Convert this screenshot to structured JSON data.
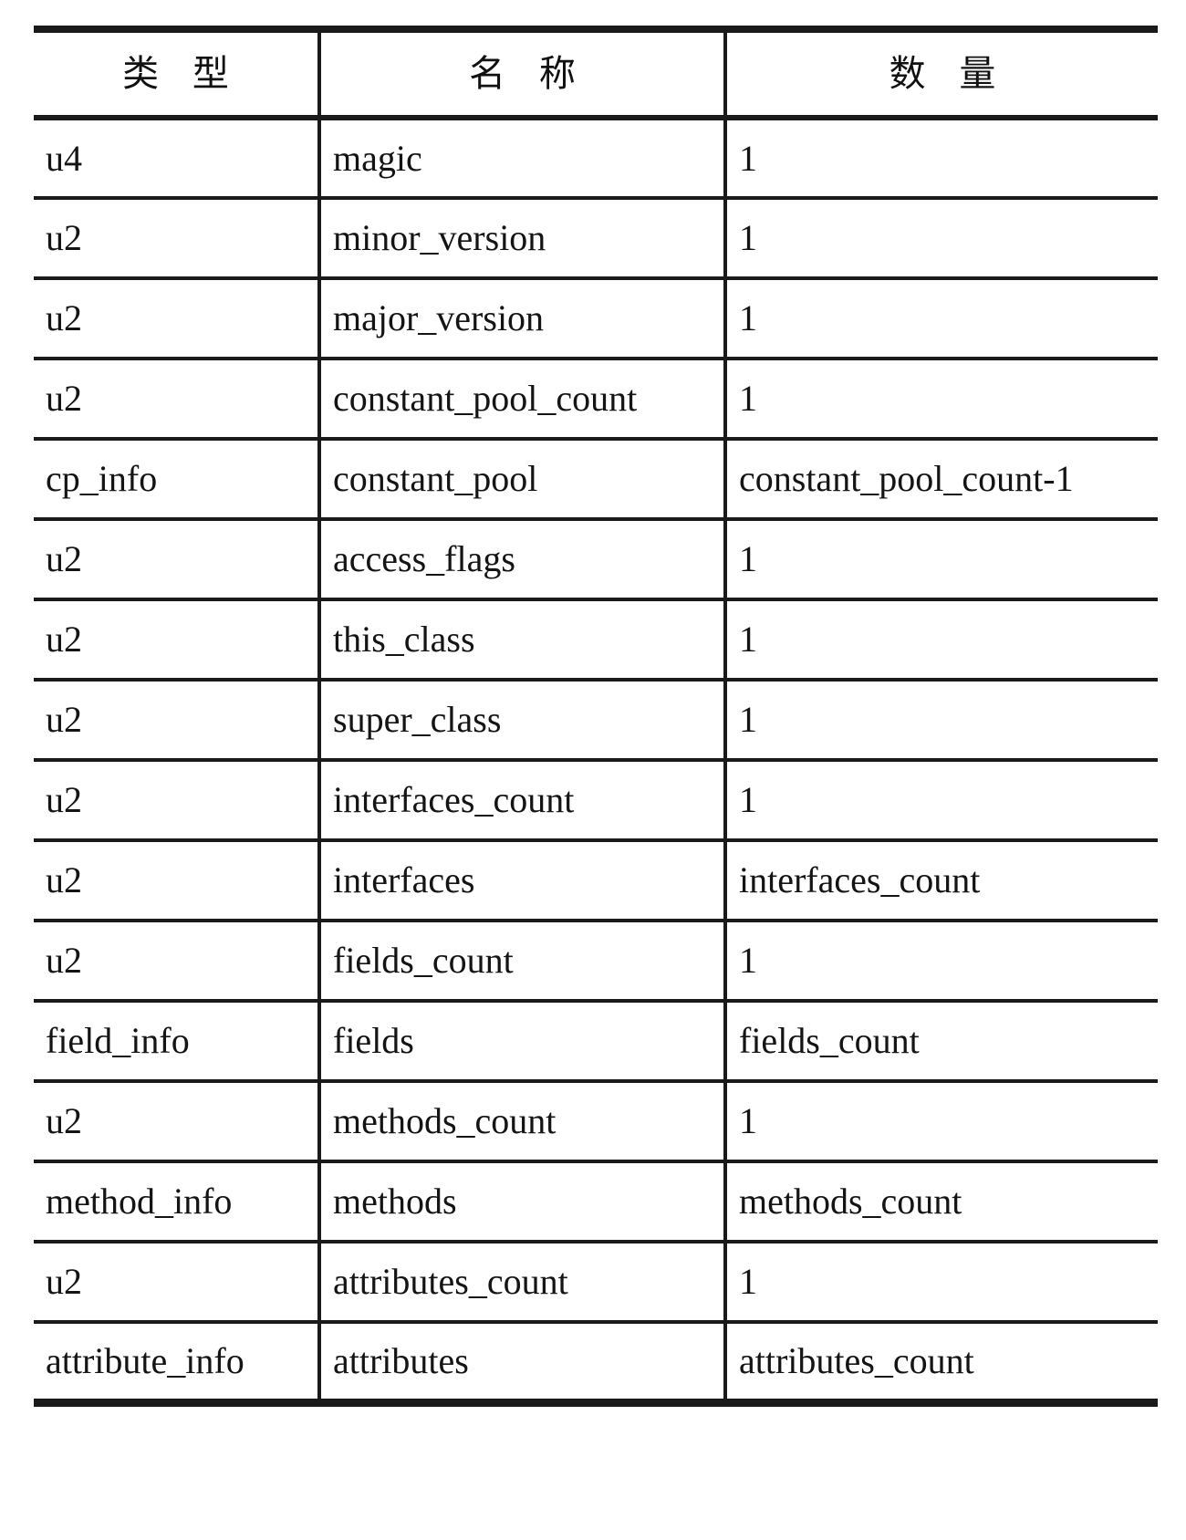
{
  "table": {
    "columns": [
      {
        "key": "type",
        "header": "类 型"
      },
      {
        "key": "name",
        "header": "名 称"
      },
      {
        "key": "quantity",
        "header": "数 量"
      }
    ],
    "rows": [
      {
        "type": "u4",
        "name": "magic",
        "quantity": "1"
      },
      {
        "type": "u2",
        "name": "minor_version",
        "quantity": "1"
      },
      {
        "type": "u2",
        "name": "major_version",
        "quantity": "1"
      },
      {
        "type": "u2",
        "name": "constant_pool_count",
        "quantity": "1"
      },
      {
        "type": "cp_info",
        "name": "constant_pool",
        "quantity": "constant_pool_count-1"
      },
      {
        "type": "u2",
        "name": "access_flags",
        "quantity": "1"
      },
      {
        "type": "u2",
        "name": "this_class",
        "quantity": "1"
      },
      {
        "type": "u2",
        "name": "super_class",
        "quantity": "1"
      },
      {
        "type": "u2",
        "name": "interfaces_count",
        "quantity": "1"
      },
      {
        "type": "u2",
        "name": "interfaces",
        "quantity": "interfaces_count"
      },
      {
        "type": "u2",
        "name": "fields_count",
        "quantity": "1"
      },
      {
        "type": "field_info",
        "name": "fields",
        "quantity": "fields_count"
      },
      {
        "type": "u2",
        "name": "methods_count",
        "quantity": "1"
      },
      {
        "type": "method_info",
        "name": "methods",
        "quantity": "methods_count"
      },
      {
        "type": "u2",
        "name": "attributes_count",
        "quantity": "1"
      },
      {
        "type": "attribute_info",
        "name": "attributes",
        "quantity": "attributes_count"
      }
    ]
  },
  "style": {
    "rule_color": "#1a1a1a",
    "text_color": "#141414",
    "background": "#ffffff"
  }
}
